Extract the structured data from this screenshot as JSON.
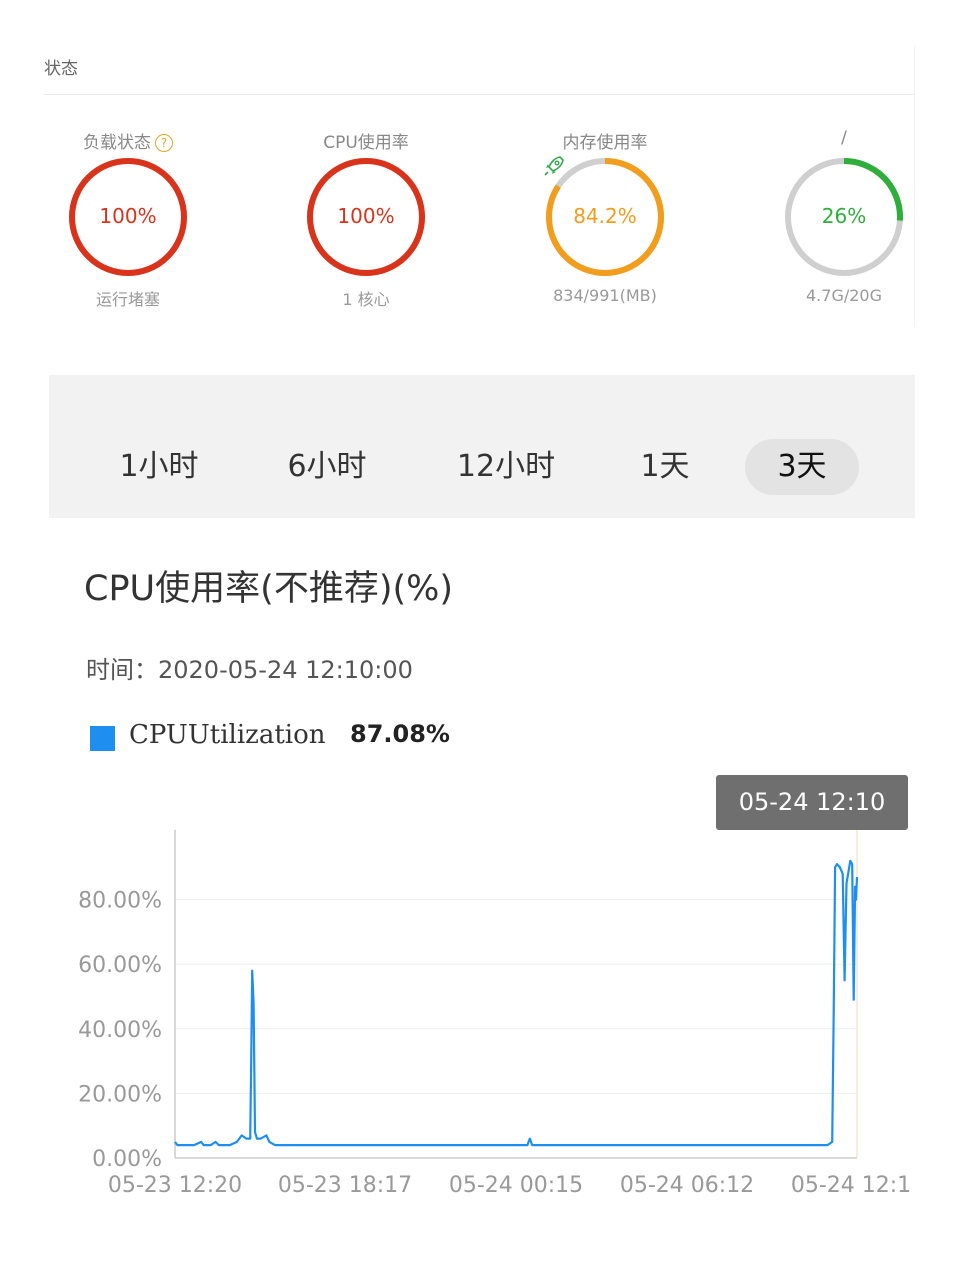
{
  "status": {
    "title": "状态",
    "gauges": [
      {
        "label": "负载状态",
        "has_help": true,
        "help_glyph": "?",
        "value": "100%",
        "percent": 100,
        "sub": "运行堵塞",
        "color": "#d9341b",
        "text_color": "#d9341b",
        "icon": ""
      },
      {
        "label": "CPU使用率",
        "has_help": false,
        "value": "100%",
        "percent": 100,
        "sub": "1 核心",
        "color": "#d9341b",
        "text_color": "#d9341b",
        "icon": ""
      },
      {
        "label": "内存使用率",
        "has_help": false,
        "value": "84.2%",
        "percent": 84.2,
        "sub": "834/991(MB)",
        "color": "#f29d1c",
        "text_color": "#f29d1c",
        "icon": "rocket-icon"
      },
      {
        "label": "/",
        "has_help": false,
        "value": "26%",
        "percent": 26,
        "sub": "4.7G/20G",
        "color": "#2fae3c",
        "text_color": "#2fae3c",
        "icon": ""
      }
    ]
  },
  "tabs": [
    {
      "label": "1小时",
      "active": false
    },
    {
      "label": "6小时",
      "active": false
    },
    {
      "label": "12小时",
      "active": false
    },
    {
      "label": "1天",
      "active": false
    },
    {
      "label": "3天",
      "active": true
    }
  ],
  "chart_section": {
    "title": "CPU使用率(不推荐)(%)",
    "time_label": "时间：",
    "time_value": "2020-05-24 12:10:00",
    "legend_name": "CPUUtilization",
    "legend_value": "87.08%",
    "legend_color": "#1e8ff0",
    "tooltip": "05-24 12:10"
  },
  "chart_data": {
    "type": "line",
    "ylim": [
      0,
      100
    ],
    "y_ticks": [
      {
        "value": 0,
        "label": "0.00%"
      },
      {
        "value": 20,
        "label": "20.00%"
      },
      {
        "value": 40,
        "label": "40.00%"
      },
      {
        "value": 60,
        "label": "60.00%"
      },
      {
        "value": 80,
        "label": "80.00%"
      }
    ],
    "x_range": [
      0,
      2870
    ],
    "x_ticks": [
      {
        "value": 0,
        "label": "05-23 12:20"
      },
      {
        "value": 357,
        "label": "05-23 18:17"
      },
      {
        "value": 715,
        "label": "05-24 00:15"
      },
      {
        "value": 1072,
        "label": "05-24 06:12"
      },
      {
        "value": 1430,
        "label": "05-24 12:1"
      }
    ],
    "series": [
      {
        "name": "CPUUtilization",
        "color": "#1e8ff0",
        "x": [
          0,
          5,
          15,
          40,
          55,
          60,
          75,
          85,
          92,
          115,
          130,
          140,
          150,
          158,
          160,
          162,
          165,
          168,
          170,
          172,
          180,
          192,
          198,
          210,
          230,
          250,
          300,
          350,
          400,
          450,
          500,
          550,
          600,
          650,
          700,
          740,
          745,
          750,
          800,
          850,
          900,
          950,
          1000,
          1050,
          1100,
          1150,
          1200,
          1250,
          1300,
          1350,
          1360,
          1370,
          1380,
          1383,
          1386,
          1390,
          1396,
          1402,
          1406,
          1410,
          1418,
          1422,
          1425,
          1428,
          1430,
          1432
        ],
        "values": [
          5,
          4,
          4,
          4,
          5,
          4,
          4,
          5,
          4,
          4,
          5,
          7,
          6,
          6,
          30,
          58,
          48,
          8,
          7,
          6,
          6,
          7,
          5,
          4,
          4,
          4,
          4,
          4,
          4,
          4,
          4,
          4,
          4,
          4,
          4,
          4,
          6,
          4,
          4,
          4,
          4,
          4,
          4,
          4,
          4,
          4,
          4,
          4,
          4,
          4,
          4,
          4,
          5,
          45,
          90,
          91,
          90,
          88,
          55,
          85,
          92,
          91,
          49,
          84,
          80,
          87
        ]
      }
    ]
  }
}
